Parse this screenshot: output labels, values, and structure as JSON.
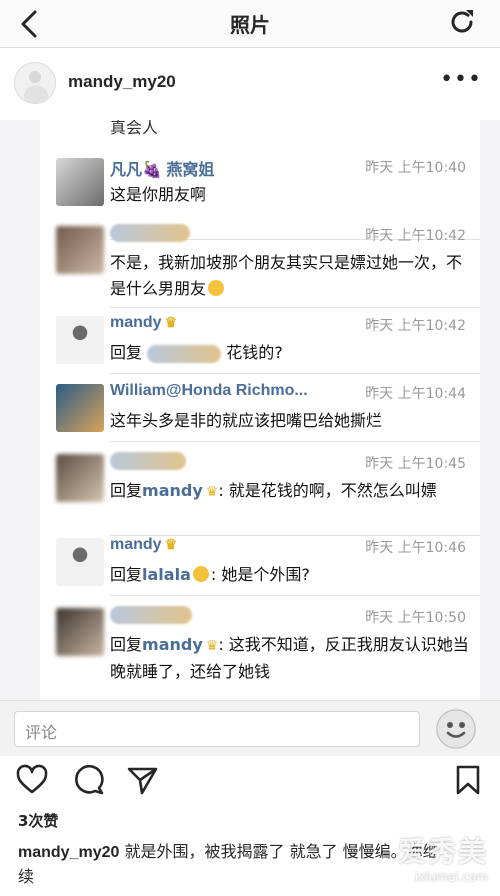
{
  "nav": {
    "title": "照片"
  },
  "post": {
    "username": "mandy_my20",
    "more_label": "•••"
  },
  "photo": {
    "cut_text": "真会人",
    "messages": [
      {
        "name": "凡凡🍇 燕窝姐",
        "time": "昨天  上午10:40",
        "body": "这是你朋友啊"
      },
      {
        "name": "",
        "time": "昨天  上午10:42",
        "body": "不是，我新加坡那个朋友其实只是嫖过她一次，不是什么男朋友"
      },
      {
        "name": "mandy",
        "time": "昨天  上午10:42",
        "body_prefix": "回复",
        "body_suffix": "花钱的?"
      },
      {
        "name": "William@Honda Richmo...",
        "time": "昨天  上午10:44",
        "body": "这年头多是非的就应该把嘴巴给她撕烂"
      },
      {
        "name": "",
        "time": "昨天  上午10:45",
        "body_prefix": "回复",
        "mention": "mandy",
        "body_suffix": ": 就是花钱的啊，不然怎么叫嫖"
      },
      {
        "name": "mandy",
        "time": "昨天  上午10:46",
        "body_prefix": "回复",
        "mention": "lalala",
        "body_suffix": ": 她是个外围?"
      },
      {
        "name": "",
        "time": "昨天  上午10:50",
        "body_prefix": "回复",
        "mention": "mandy",
        "body_suffix": ": 这我不知道，反正我朋友认识她当晚就睡了，还给了她钱"
      }
    ]
  },
  "comment": {
    "placeholder": "评论"
  },
  "likes": "3次赞",
  "caption": {
    "user": "mandy_my20",
    "text": " 就是外围，被我揭露了 就急了 慢慢编。你继续"
  },
  "watermark": {
    "big": "爱秀美",
    "small": "ixiumei.com"
  },
  "colors": {
    "link": "#4a6e99",
    "time": "#9a9a9a",
    "bg": "#f3f3f5"
  }
}
